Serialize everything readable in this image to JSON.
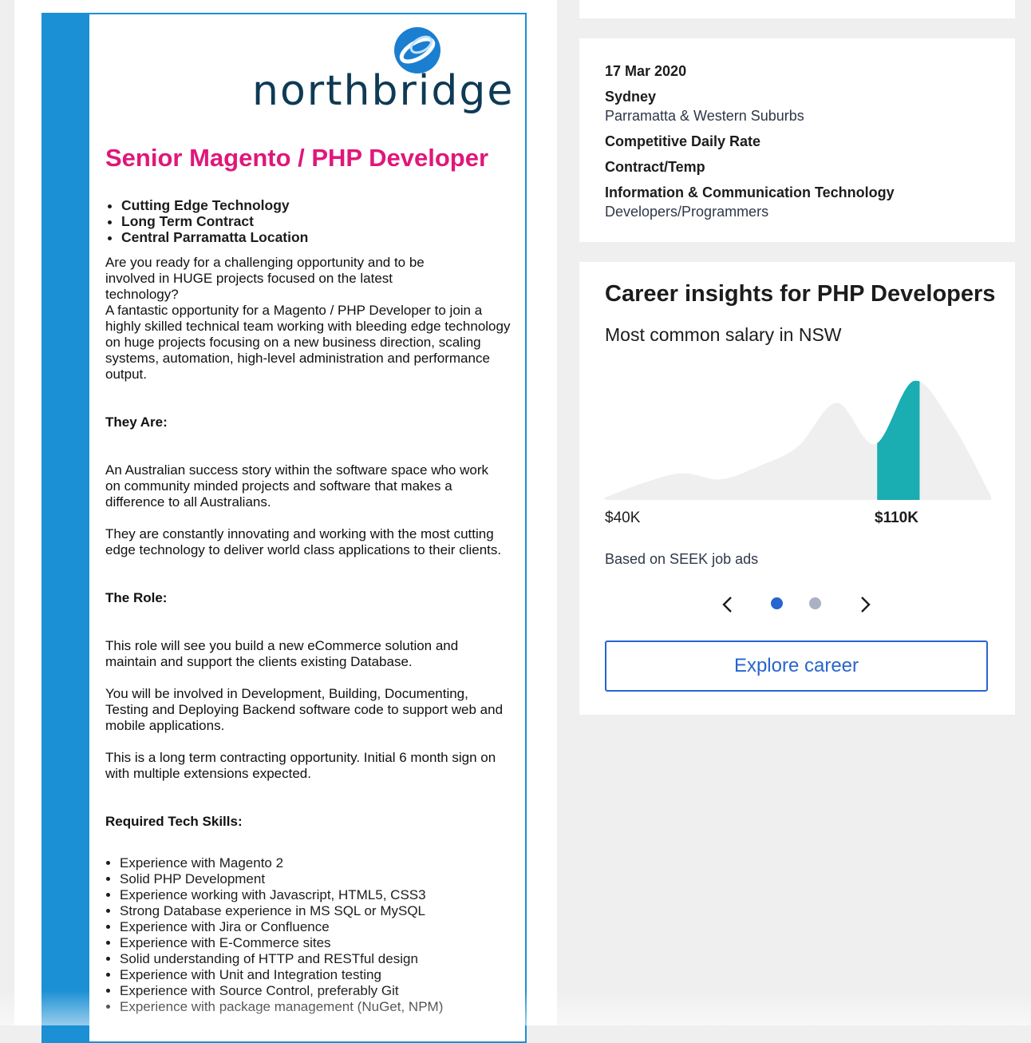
{
  "ad": {
    "logo_text": "northbridge",
    "title": "Senior Magento / PHP Developer",
    "highlights": [
      "Cutting Edge Technology",
      "Long Term Contract",
      "Central Parramatta Location"
    ],
    "intro_1": "Are you ready for a challenging opportunity and to be involved in HUGE projects focused on the latest technology?",
    "intro_2": "A fantastic opportunity for a Magento / PHP Developer  to join a highly skilled technical team working with bleeding edge technology on huge projects focusing on a new business direction, scaling systems, automation, high-level administration and performance output.",
    "they_are_heading": "They Are:",
    "they_are_1": "An Australian success story within the software space who work on community minded projects and software that makes a difference to all Australians.",
    "they_are_2": "They are constantly innovating and working with the most cutting edge technology to deliver world class applications to their clients.",
    "role_heading": "The Role:",
    "role_1": "This role will see you build a new eCommerce solution and maintain and support the clients existing Database.",
    "role_2": "You will be involved in Development, Building, Documenting, Testing and Deploying Backend software code to support web and mobile applications.",
    "role_3": "This is a long term contracting opportunity. Initial 6 month sign on with multiple extensions expected.",
    "skills_heading": "Required Tech Skills:",
    "skills": [
      "Experience with Magento 2",
      "Solid PHP Development",
      "Experience working with Javascript, HTML5, CSS3",
      "Strong Database experience in MS SQL or MySQL",
      "Experience with Jira or Confluence",
      "Experience with E-Commerce sites",
      "Solid understanding of HTTP and RESTful design",
      "Experience with Unit and Integration testing",
      "Experience with Source Control, preferably Git",
      "Experience with package management (NuGet, NPM)"
    ]
  },
  "details": {
    "date": "17 Mar 2020",
    "location": "Sydney",
    "area": "Parramatta & Western Suburbs",
    "salary": "Competitive Daily Rate",
    "work_type": "Contract/Temp",
    "classification": "Information & Communication Technology",
    "sub_classification": "Developers/Programmers"
  },
  "insights": {
    "title": "Career insights for PHP Developers",
    "subtitle": "Most common salary in NSW",
    "based_on": "Based on SEEK job ads",
    "explore_label": "Explore career",
    "page_count": 2,
    "current_page": 1
  },
  "chart_data": {
    "type": "area",
    "x_labels": [
      "$40K",
      "$110K"
    ],
    "highlight_label": "$110K",
    "highlight_color": "#1aadb1",
    "base_color": "#efefef",
    "x": [
      40,
      50,
      60,
      70,
      80,
      90,
      100,
      110,
      120,
      130,
      140
    ],
    "values": [
      0.02,
      0.14,
      0.22,
      0.17,
      0.28,
      0.44,
      0.8,
      0.46,
      0.98,
      0.62,
      0.03
    ]
  },
  "colors": {
    "accent": "#2765cf",
    "brand_pink": "#e0177a",
    "ad_blue": "#1b90d4"
  }
}
